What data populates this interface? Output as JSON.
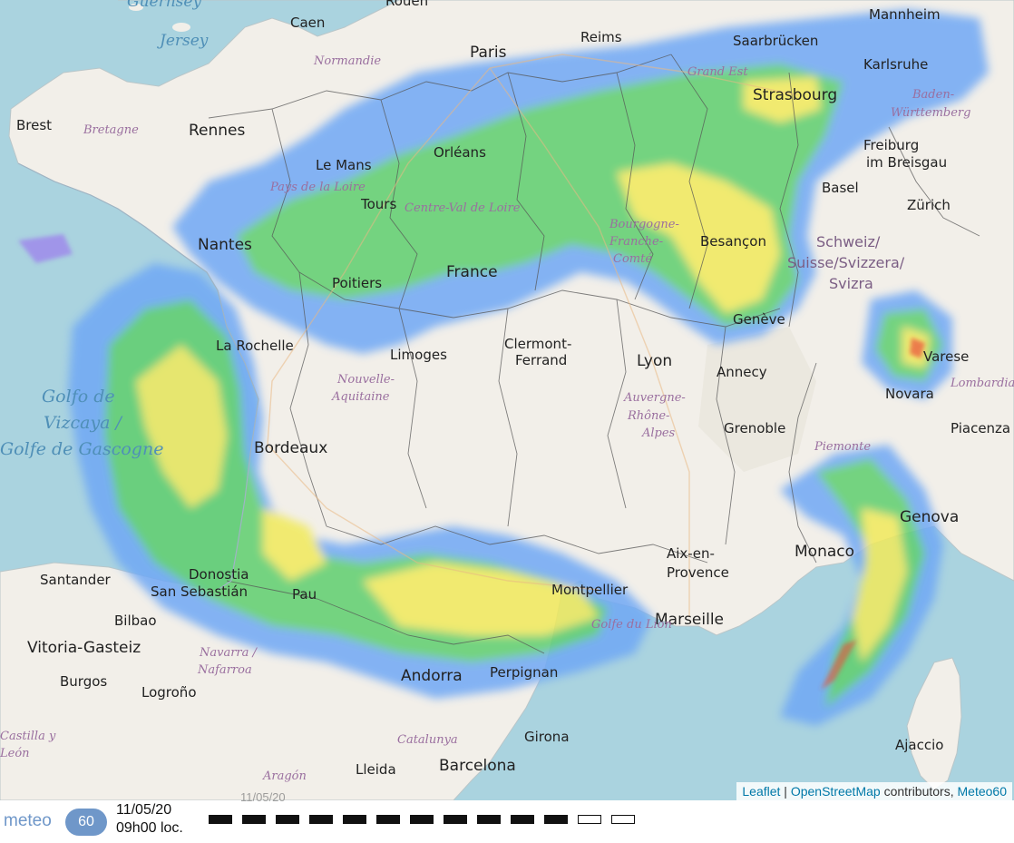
{
  "map": {
    "cities": [
      {
        "name": "Caen",
        "big": false
      },
      {
        "name": "Rouen",
        "big": false
      },
      {
        "name": "Paris",
        "big": true
      },
      {
        "name": "Reims",
        "big": false
      },
      {
        "name": "Saarbrücken",
        "big": false
      },
      {
        "name": "Mannheim",
        "big": false
      },
      {
        "name": "Karlsruhe",
        "big": false
      },
      {
        "name": "Strasbourg",
        "big": true
      },
      {
        "name": "Brest",
        "big": false
      },
      {
        "name": "Rennes",
        "big": true
      },
      {
        "name": "Le Mans",
        "big": false
      },
      {
        "name": "Orléans",
        "big": false
      },
      {
        "name": "Freiburg",
        "big": false
      },
      {
        "name": "im Breisgau",
        "big": false
      },
      {
        "name": "Basel",
        "big": false
      },
      {
        "name": "Zürich",
        "big": false
      },
      {
        "name": "Tours",
        "big": false
      },
      {
        "name": "Nantes",
        "big": true
      },
      {
        "name": "France",
        "big": true
      },
      {
        "name": "Besançon",
        "big": false
      },
      {
        "name": "Poitiers",
        "big": false
      },
      {
        "name": "Genève",
        "big": false
      },
      {
        "name": "La Rochelle",
        "big": false
      },
      {
        "name": "Limoges",
        "big": false
      },
      {
        "name": "Clermont-",
        "big": false
      },
      {
        "name": "Ferrand",
        "big": false
      },
      {
        "name": "Lyon",
        "big": true
      },
      {
        "name": "Annecy",
        "big": false
      },
      {
        "name": "Varese",
        "big": false
      },
      {
        "name": "Novara",
        "big": false
      },
      {
        "name": "Bordeaux",
        "big": true
      },
      {
        "name": "Grenoble",
        "big": false
      },
      {
        "name": "Piacenza",
        "big": false
      },
      {
        "name": "Genova",
        "big": true
      },
      {
        "name": "Montpellier",
        "big": false
      },
      {
        "name": "Aix-en-",
        "big": false
      },
      {
        "name": "Provence",
        "big": false
      },
      {
        "name": "Monaco",
        "big": true
      },
      {
        "name": "Santander",
        "big": false
      },
      {
        "name": "Donostia",
        "big": false
      },
      {
        "name": "San Sebastián",
        "big": false
      },
      {
        "name": "Pau",
        "big": false
      },
      {
        "name": "Bilbao",
        "big": false
      },
      {
        "name": "Marseille",
        "big": true
      },
      {
        "name": "Vitoria-Gasteiz",
        "big": true
      },
      {
        "name": "Burgos",
        "big": false
      },
      {
        "name": "Andorra",
        "big": true
      },
      {
        "name": "Perpignan",
        "big": false
      },
      {
        "name": "Logroño",
        "big": false
      },
      {
        "name": "Girona",
        "big": false
      },
      {
        "name": "Ajaccio",
        "big": false
      },
      {
        "name": "Barcelona",
        "big": true
      },
      {
        "name": "Lleida",
        "big": false
      }
    ],
    "regions": [
      "Normandie",
      "Bretagne",
      "Grand Est",
      "Baden-",
      "Württemberg",
      "Pays de la Loire",
      "Centre-Val de Loire",
      "Bourgogne-",
      "Franche-",
      "Comté",
      "Nouvelle-",
      "Aquitaine",
      "Auvergne-",
      "Rhône-",
      "Alpes",
      "Piemonte",
      "Lombardia",
      "Navarra /",
      "Nafarroa",
      "Catalunya",
      "Aragón",
      "Castilla y",
      "León",
      "Golfe du Lion"
    ],
    "countries": [
      "Schweiz/",
      "Suisse/Svizzera/",
      "Svizra"
    ],
    "seas": [
      "Golfo de",
      "Vizcaya /",
      "Golfe de Gascogne"
    ],
    "islands": [
      "Guernsey",
      "Jersey"
    ]
  },
  "attribution": {
    "leaflet": "Leaflet",
    "separator": " | ",
    "osm": "OpenStreetMap",
    "contributors": " contributors, ",
    "meteo": "Meteo60"
  },
  "footer": {
    "logo_word": "meteo",
    "logo_number": "60",
    "date": "11/05/20",
    "time": "09h00 loc.",
    "ghost_date": "11/05/20",
    "frames_total": 13,
    "current_frame": 11
  },
  "colors": {
    "sea": "#aad3df",
    "land": "#f2efe9",
    "radar_light": "#6fa8f5",
    "radar_mid": "#5ecf6e",
    "radar_high": "#f1ea5c",
    "radar_extreme": "#e8503c",
    "logo": "#6f97c9"
  }
}
